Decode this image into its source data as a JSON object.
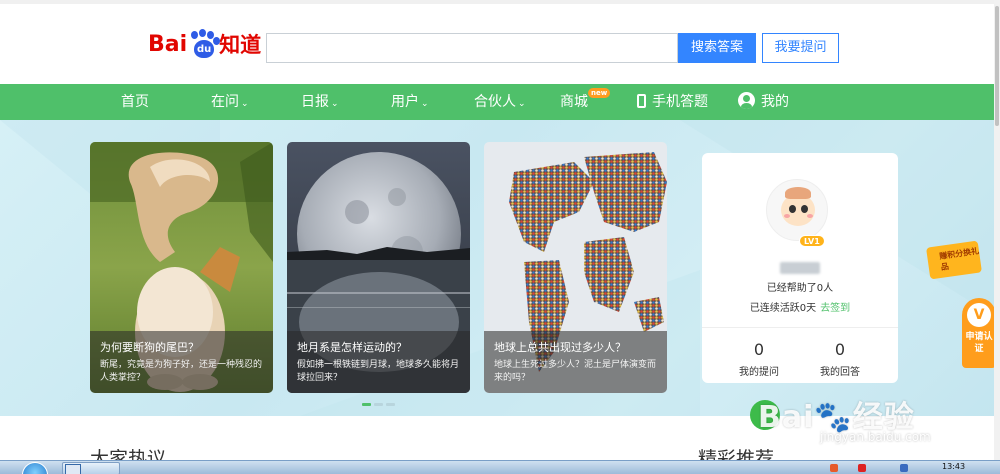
{
  "logo": {
    "brand": "Bai",
    "paw_text": "du",
    "product": "知道"
  },
  "search": {
    "placeholder": "",
    "value": "",
    "search_button": "搜索答案",
    "ask_button": "我要提问"
  },
  "nav": {
    "items": [
      {
        "label": "首页",
        "dropdown": false
      },
      {
        "label": "在问",
        "dropdown": true
      },
      {
        "label": "日报",
        "dropdown": true
      },
      {
        "label": "用户",
        "dropdown": true
      },
      {
        "label": "合伙人",
        "dropdown": true
      },
      {
        "label": "商城",
        "badge": "new"
      },
      {
        "label": "手机答题",
        "icon": "phone-icon"
      },
      {
        "label": "我的",
        "icon": "user-icon"
      }
    ]
  },
  "carousel": {
    "cards": [
      {
        "title": "为何要断狗的尾巴？",
        "desc": "断尾，究竟是为狗子好，还是一种残忍的人类掌控？",
        "image": "fox-dog-tail"
      },
      {
        "title": "地月系是怎样运动的？",
        "desc": "假如拂一根铁链到月球，地球多久能将月球拉回来？",
        "image": "moon-over-sea"
      },
      {
        "title": "地球上总共出现过多少人？",
        "desc": "地球上生死过多少人？泥土是尸体演变而来的吗？",
        "image": "crowd-world-map"
      }
    ],
    "active_index": 0,
    "total": 3
  },
  "user_panel": {
    "level": "LV1",
    "helped_text": "已经帮助了0人",
    "streak_text": "已连续活跃0天",
    "checkin_text": "去签到",
    "stats": [
      {
        "value": "0",
        "label": "我的提问"
      },
      {
        "value": "0",
        "label": "我的回答"
      }
    ]
  },
  "side": {
    "gift_text": "赚积分换礼品",
    "apply_text": "申请认证"
  },
  "sections": {
    "hot": "大家热议",
    "featured": "精彩推荐"
  },
  "watermark": {
    "brand": "Bai",
    "brand2": "经验",
    "url": "jingyan.baidu.com"
  },
  "taskbar": {
    "time": "13:43"
  },
  "colors": {
    "nav_green": "#4fc06a",
    "search_blue": "#3385ff",
    "brand_red": "#e10601"
  }
}
